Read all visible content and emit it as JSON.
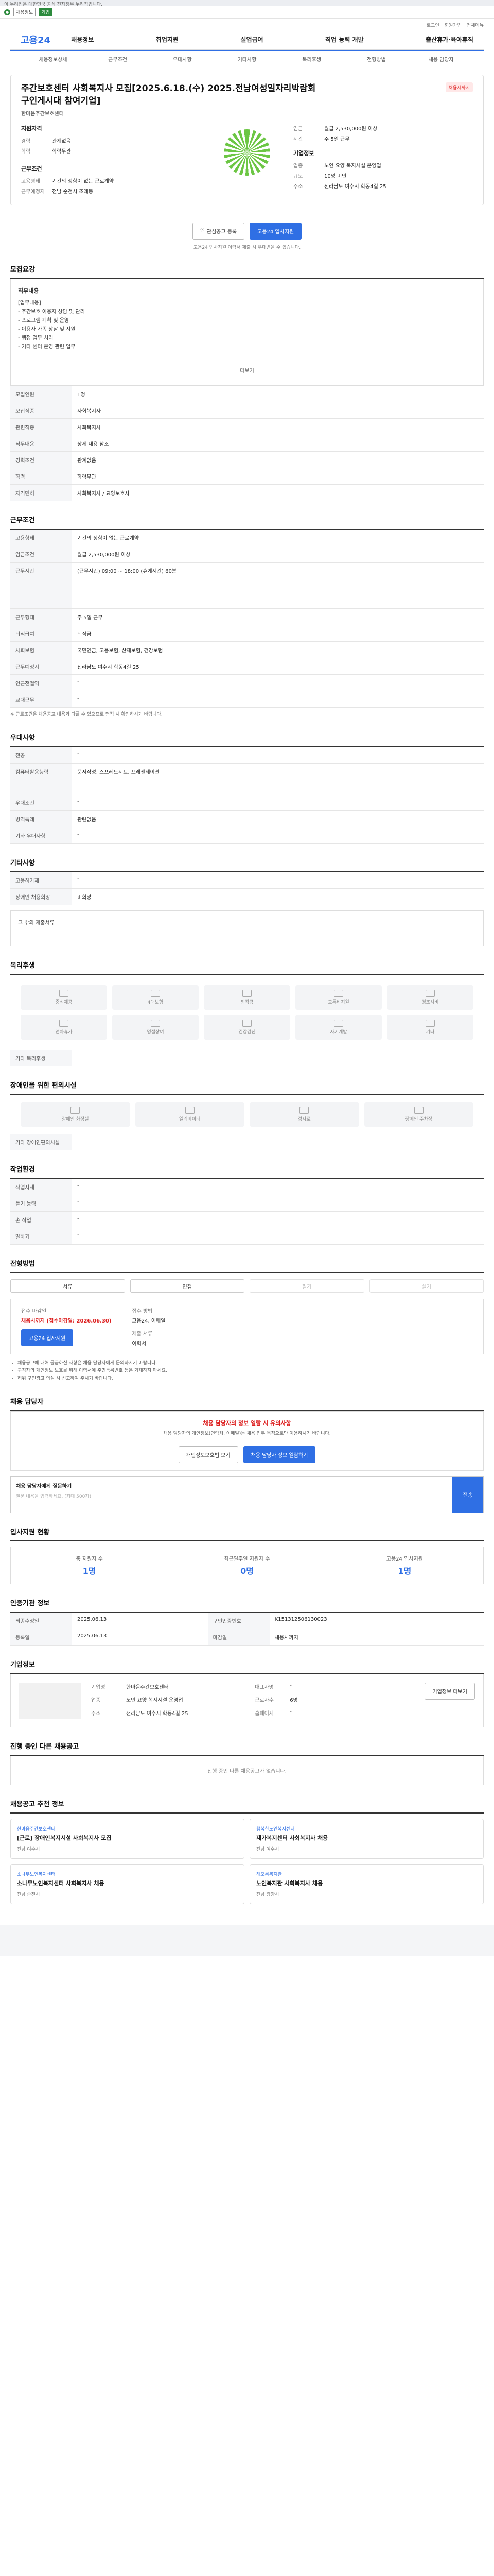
{
  "topbar": {
    "notice": "이 누리집은 대한민국 공식 전자정부 누리집입니다."
  },
  "toolbar": {
    "select": "채용정보",
    "label": "기업"
  },
  "util": {
    "links": [
      "로그인",
      "회원가입",
      "전체메뉴"
    ]
  },
  "brand": {
    "name_a": "고용",
    "name_b": "24"
  },
  "gnb": [
    "채용정보",
    "취업지원",
    "실업급여",
    "직업 능력 개발",
    "출산휴가·육아휴직"
  ],
  "subnav": [
    "채용정보상세",
    "근무조건",
    "우대사항",
    "기타사항",
    "복리후생",
    "전형방법",
    "채용 담당자"
  ],
  "job": {
    "title": "주간보호센터 사회복지사 모집[2025.6.18.(수) 2025.전남여성일자리박람회 구인게시대 참여기업]",
    "badge": "채용시까지",
    "company": "한마음주간보호센터",
    "qual_h": "지원자격",
    "cond_h": "근무조건",
    "co_h": "기업정보",
    "qual": [
      {
        "k": "경력",
        "v": "관계없음"
      },
      {
        "k": "학력",
        "v": "학력무관"
      }
    ],
    "cond": [
      {
        "k": "고용형태",
        "v": "기간의 정함이 없는 근로계약"
      },
      {
        "k": "근무예정지",
        "v": "전남 순천시 조례동"
      }
    ],
    "cond2": [
      {
        "k": "임금",
        "v": "월급 2,530,000원 이상"
      },
      {
        "k": "시간",
        "v": "주 5일 근무"
      }
    ],
    "co": [
      {
        "k": "업종",
        "v": "노인 요양 복지시설 운영업"
      },
      {
        "k": "규모",
        "v": "10명 미만"
      },
      {
        "k": "주소",
        "v": "전라남도 여수시 학동4길 25"
      }
    ]
  },
  "actions": {
    "scrap": "관심공고 등록",
    "apply": "고용24 입사지원"
  },
  "notice": "고용24 입사지원 이력서 제출 시 우대받을 수 있습니다.",
  "duty": {
    "section": "모집요강",
    "title": "직무내용",
    "text": "[업무내용]\n- 주간보호 이용자 상담 및 관리\n- 프로그램 계획 및 운영\n- 이용자 가족 상담 및 지원\n- 행정 업무 처리\n- 기타 센터 운영 관련 업무",
    "more": "더보기"
  },
  "rows1": [
    {
      "k": "모집인원",
      "v": "1명"
    },
    {
      "k": "모집직종",
      "v": "사회복지사"
    },
    {
      "k": "관련직종",
      "v": "사회복지사"
    },
    {
      "k": "직무내용",
      "v": "상세 내용 참조"
    },
    {
      "k": "경력조건",
      "v": "관계없음"
    },
    {
      "k": "학력",
      "v": "학력무관"
    },
    {
      "k": "자격면허",
      "v": "사회복지사 / 요양보호사"
    }
  ],
  "cond_section": "근무조건",
  "rows2": [
    {
      "k": "고용형태",
      "v": "기간의 정함이 없는 근로계약"
    },
    {
      "k": "임금조건",
      "v": "월급 2,530,000원 이상"
    },
    {
      "k": "근무시간",
      "v": "(근무시간) 09:00 ~ 18:00 (휴게시간) 60분"
    },
    {
      "k": "근무형태",
      "v": "주 5일 근무"
    },
    {
      "k": "퇴직급여",
      "v": "퇴직금"
    },
    {
      "k": "사회보험",
      "v": "국민연금, 고용보험, 산재보험, 건강보험"
    },
    {
      "k": "근무예정지",
      "v": "전라남도 여수시 학동4길 25"
    },
    {
      "k": "인근전철역",
      "v": "-"
    },
    {
      "k": "교대근무",
      "v": "-"
    }
  ],
  "cond_note": "※ 근로조건은 채용공고 내용과 다를 수 있으므로 면접 시 확인하시기 바랍니다.",
  "pref_section": "우대사항",
  "rows3": [
    {
      "k": "전공",
      "v": "-"
    },
    {
      "k": "컴퓨터활용능력",
      "v": "문서작성, 스프레드시트, 프레젠테이션"
    },
    {
      "k": "우대조건",
      "v": "-"
    },
    {
      "k": "병역특례",
      "v": "관련없음"
    },
    {
      "k": "기타 우대사항",
      "v": "-"
    }
  ],
  "etc_section": "기타사항",
  "rows4": [
    {
      "k": "고용허가제",
      "v": "-"
    },
    {
      "k": "장애인 채용희망",
      "v": "비희망"
    }
  ],
  "etc_foot": "그 밖의 제출서류",
  "welfare_section": "복리후생",
  "welfare": [
    "중식제공",
    "4대보험",
    "퇴직금",
    "교통비지원",
    "경조사비",
    "연차휴가",
    "명절상여",
    "건강검진",
    "자기계발",
    "기타"
  ],
  "welfare_note": "기타 복리후생",
  "dis_section": "장애인을 위한 편의시설",
  "dis": [
    "장애인 화장실",
    "엘리베이터",
    "경사로",
    "장애인 주차장"
  ],
  "dis_note": "기타 장애인편의시설",
  "env_section": "작업환경",
  "rows5": [
    {
      "k": "작업자세",
      "v": "-"
    },
    {
      "k": "듣기 능력",
      "v": "-"
    },
    {
      "k": "손 작업",
      "v": "-"
    },
    {
      "k": "말하기",
      "v": "-"
    }
  ],
  "sel_section": "전형방법",
  "methods": [
    "서류",
    "면접",
    "필기",
    "실기"
  ],
  "apply_block": {
    "k1": "접수 마감일",
    "v1": "채용시까지 (접수마감일: 2026.06.30)",
    "k2": "접수 방법",
    "v2": "고용24, 이메일",
    "k3": "제출 서류",
    "v3": "이력서",
    "btn": "고용24 입사지원"
  },
  "apply_bullets": [
    "채용공고에 대해 궁금하신 사항은 채용 담당자에게 문의하시기 바랍니다.",
    "구직자의 개인정보 보호를 위해 이력서에 주민등록번호 등은 기재하지 마세요.",
    "허위 구인광고 의심 시 신고하여 주시기 바랍니다."
  ],
  "contact_section": "채용 담당자",
  "contact_head": "채용 담당자의 정보 열람 시 유의사항",
  "contact_text": "채용 담당자의 개인정보(연락처, 이메일)는 채용 업무 목적으로만 이용하시기 바랍니다.",
  "contact_btns": [
    "개인정보보호법 보기",
    "채용 담당자 정보 열람하기"
  ],
  "ask": {
    "h": "채용 담당자에게 질문하기",
    "p": "질문 내용을 입력하세요. (최대 500자)",
    "send": "전송"
  },
  "stat_section": "입사지원 현황",
  "stats": [
    {
      "k": "총 지원자 수",
      "v": "1명"
    },
    {
      "k": "최근일주일 지원자 수",
      "v": "0명"
    },
    {
      "k": "고용24 입사지원",
      "v": "1명"
    }
  ],
  "detail_section": "인증기관 정보",
  "rows6": [
    {
      "k": "최종수정일",
      "v": "2025.06.13"
    },
    {
      "k": "구인인증번호",
      "v": "K151312506130023"
    },
    {
      "k": "등록일",
      "v": "2025.06.13"
    },
    {
      "k": "마감일",
      "v": "채용시까지"
    }
  ],
  "company_section": "기업정보",
  "company_rows": [
    {
      "k": "기업명",
      "v": "한마음주간보호센터"
    },
    {
      "k": "대표자명",
      "v": "-"
    },
    {
      "k": "업종",
      "v": "노인 요양 복지시설 운영업"
    },
    {
      "k": "근로자수",
      "v": "6명"
    },
    {
      "k": "주소",
      "v": "전라남도 여수시 학동4길 25"
    },
    {
      "k": "홈페이지",
      "v": "-"
    }
  ],
  "company_btn": "기업정보 더보기",
  "progress_section": "진행 중인 다른 채용공고",
  "progress_empty": "진행 중인 다른 채용공고가 없습니다.",
  "reco_section": "채용공고 추천 정보",
  "reco": [
    {
      "c": "한마음주간보호센터",
      "t": "[근로] 장애인복지시설 사회복지사 모집",
      "m": "전남 여수시"
    },
    {
      "c": "행복한노인복지센터",
      "t": "재가복지센터 사회복지사 채용",
      "m": "전남 여수시"
    },
    {
      "c": "소나무노인복지센터",
      "t": "소나무노인복지센터 사회복지사 채용",
      "m": "전남 순천시"
    },
    {
      "c": "해오름복지관",
      "t": "노인복지관 사회복지사 채용",
      "m": "전남 광양시"
    }
  ]
}
